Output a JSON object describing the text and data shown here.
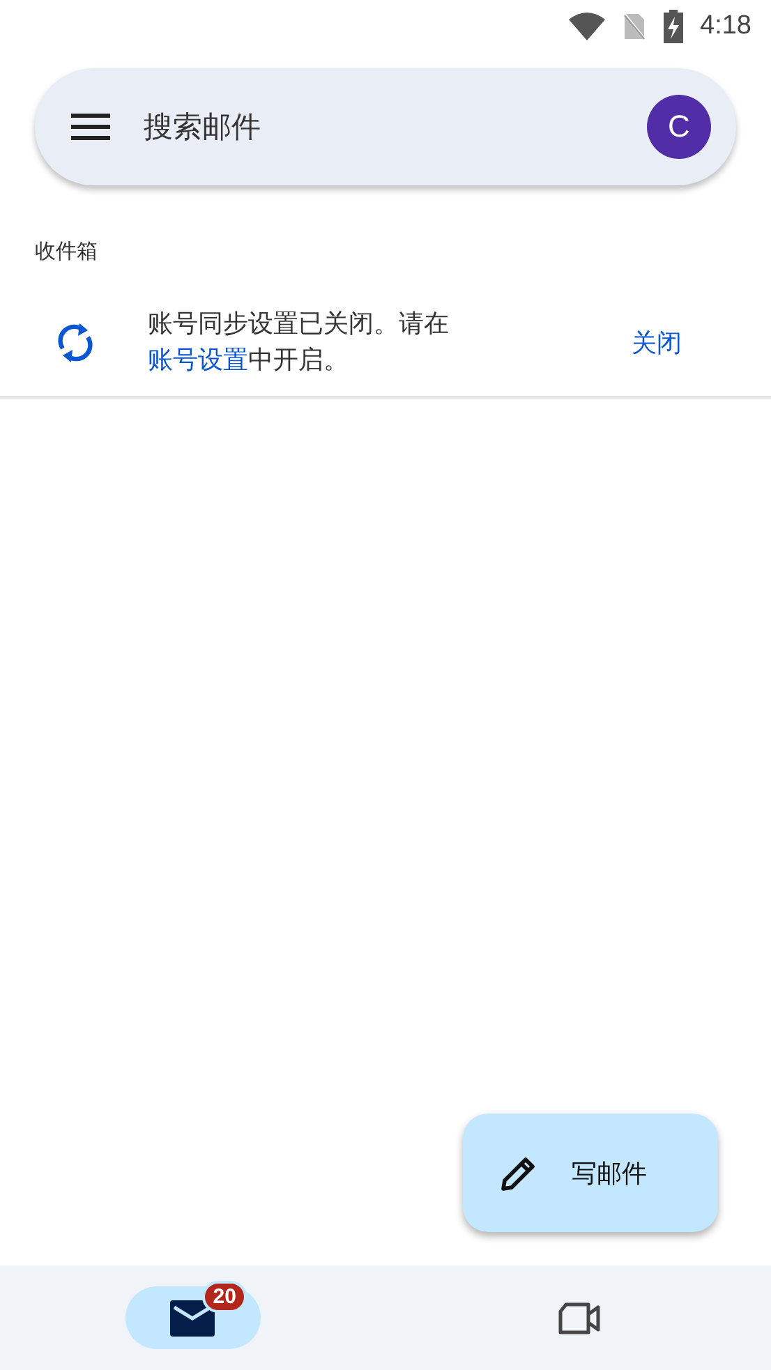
{
  "status_bar": {
    "time": "4:18"
  },
  "search": {
    "placeholder": "搜索邮件",
    "avatar_letter": "C"
  },
  "folder_title": "收件箱",
  "banner": {
    "text_before": "账号同步设置已关闭。请在",
    "link": "账号设置",
    "text_after": "中开启。",
    "action": "关闭"
  },
  "fab": {
    "label": "写邮件"
  },
  "bottom_nav": [
    {
      "kind": "mail",
      "selected": true,
      "badge": "20"
    },
    {
      "kind": "video",
      "selected": false
    }
  ]
}
